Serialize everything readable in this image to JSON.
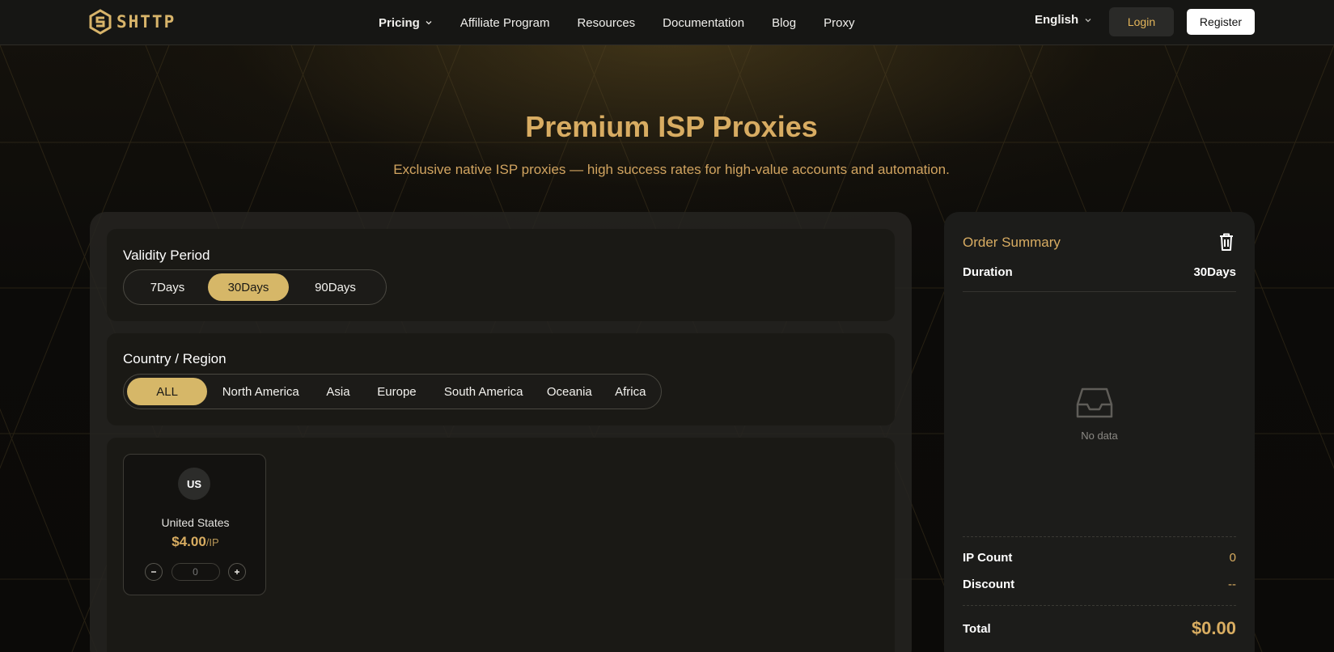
{
  "header": {
    "logo_text": "SHTTP",
    "nav": [
      {
        "label": "Pricing",
        "has_dropdown": true
      },
      {
        "label": "Affiliate Program"
      },
      {
        "label": "Resources"
      },
      {
        "label": "Documentation"
      },
      {
        "label": "Blog"
      },
      {
        "label": "Proxy"
      }
    ],
    "language": "English",
    "login_label": "Login",
    "register_label": "Register"
  },
  "hero": {
    "title": "Premium ISP Proxies",
    "subtitle": "Exclusive native ISP proxies — high success rates for high-value accounts and automation."
  },
  "validity": {
    "title": "Validity Period",
    "options": [
      "7Days",
      "30Days",
      "90Days"
    ],
    "selected": "30Days"
  },
  "region": {
    "title": "Country / Region",
    "options": [
      "ALL",
      "North America",
      "Asia",
      "Europe",
      "South America",
      "Oceania",
      "Africa"
    ],
    "selected": "ALL"
  },
  "countries": [
    {
      "code": "US",
      "name": "United States",
      "price": "$4.00",
      "unit": "/IP",
      "quantity": "0"
    }
  ],
  "summary": {
    "title": "Order Summary",
    "duration_label": "Duration",
    "duration_value": "30Days",
    "empty_text": "No data",
    "ip_count_label": "IP Count",
    "ip_count_value": "0",
    "discount_label": "Discount",
    "discount_value": "--",
    "total_label": "Total",
    "total_value": "$0.00"
  },
  "colors": {
    "accent_gold": "#d8ac62",
    "pill_active": "#d6b768",
    "background": "#0c0b09"
  }
}
